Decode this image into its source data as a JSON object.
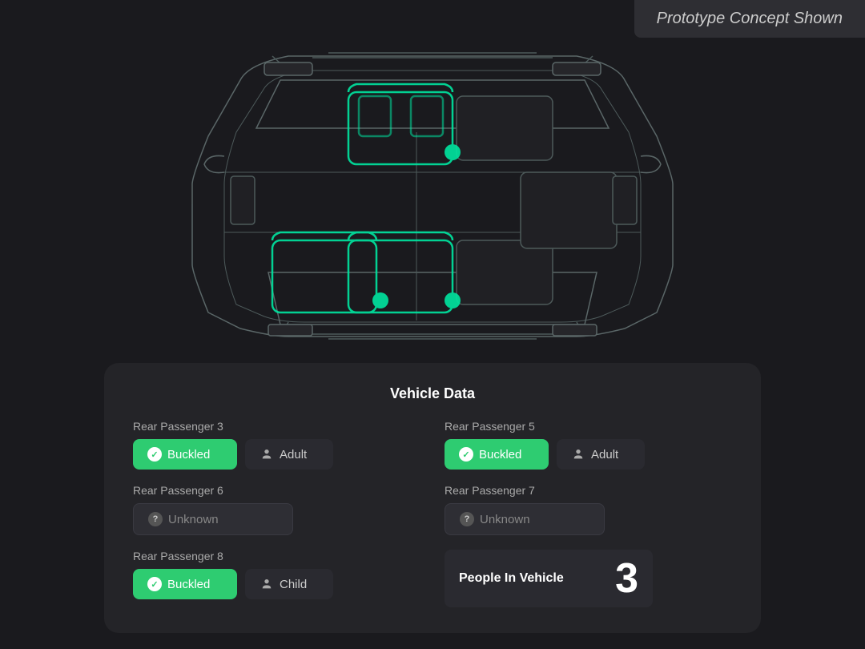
{
  "prototype_label": "Prototype Concept Shown",
  "car_area": {
    "description": "Top-down car diagram with highlighted seat sensors"
  },
  "panel": {
    "title": "Vehicle Data",
    "passengers": [
      {
        "id": "rear-passenger-3",
        "label": "Rear Passenger 3",
        "buckled": true,
        "buckled_label": "Buckled",
        "type_label": "Adult",
        "status": "buckled"
      },
      {
        "id": "rear-passenger-5",
        "label": "Rear Passenger 5",
        "buckled": true,
        "buckled_label": "Buckled",
        "type_label": "Adult",
        "status": "buckled"
      },
      {
        "id": "rear-passenger-6",
        "label": "Rear Passenger 6",
        "buckled": false,
        "unknown_label": "Unknown",
        "status": "unknown"
      },
      {
        "id": "rear-passenger-7",
        "label": "Rear Passenger 7",
        "buckled": false,
        "unknown_label": "Unknown",
        "status": "unknown"
      },
      {
        "id": "rear-passenger-8",
        "label": "Rear Passenger 8",
        "buckled": true,
        "buckled_label": "Buckled",
        "type_label": "Child",
        "status": "buckled"
      }
    ],
    "people_in_vehicle_label": "People In Vehicle",
    "people_count": "3"
  }
}
